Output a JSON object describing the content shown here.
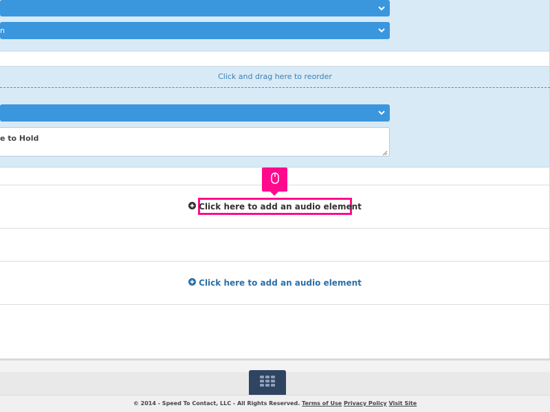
{
  "selects": {
    "top_first": {
      "value": ""
    },
    "top_second": {
      "value": "n"
    },
    "mid": {
      "value": ""
    }
  },
  "drag_hint": "Click and drag here to reorder",
  "message_textarea": {
    "value": "e to Hold"
  },
  "add_audio_links": [
    {
      "label": "Click here to add an audio element"
    },
    {
      "label": "Click here to add an audio element"
    }
  ],
  "tooltip": {
    "icon": "mouse-icon"
  },
  "footer": {
    "apps_icon": "grid-icon",
    "copyright": "© 2014 - Speed To Contact, LLC - All Rights Reserved.",
    "terms_link": "Terms of Use",
    "privacy_link": "Privacy Policy",
    "visit_link": "Visit Site"
  },
  "colors": {
    "panel_bg": "#d9eaf7",
    "select_bg": "#3a96dd",
    "highlight": "#ff0a8c",
    "link_blue": "#2a6fa8",
    "apps_button": "#2f4461"
  }
}
